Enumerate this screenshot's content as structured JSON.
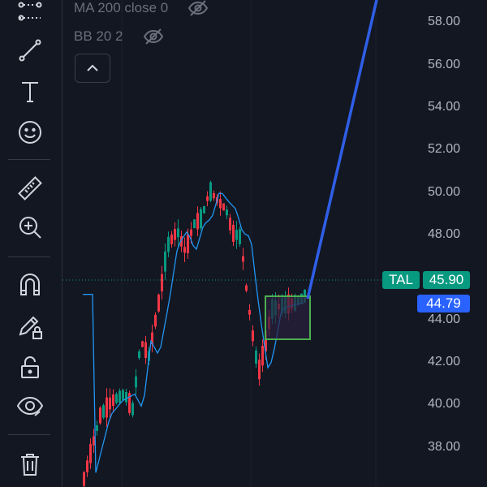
{
  "toolbar": {
    "tools": [
      {
        "name": "trend-pattern-icon"
      },
      {
        "name": "trend-line-icon"
      },
      {
        "name": "text-tool-icon"
      },
      {
        "name": "emoji-icon"
      },
      {
        "name": "ruler-icon"
      },
      {
        "name": "zoom-in-icon"
      },
      {
        "name": "magnet-icon"
      },
      {
        "name": "lock-drawings-icon"
      },
      {
        "name": "unlock-icon"
      },
      {
        "name": "eye-icon"
      },
      {
        "name": "trash-icon"
      }
    ]
  },
  "legend": {
    "ma_label": "MA 200 close 0",
    "bb_label": "BB 20 2"
  },
  "price_axis": {
    "labels": [
      "58.00",
      "56.00",
      "54.00",
      "52.00",
      "50.00",
      "48.00",
      "46.00",
      "44.00",
      "42.00",
      "40.00",
      "38.00"
    ]
  },
  "symbol_tag": {
    "symbol": "TAL",
    "price": "45.90",
    "color": "#089981"
  },
  "crosshair_tag": {
    "price": "44.79",
    "color": "#2962ff"
  },
  "colors": {
    "up": "#089981",
    "down": "#f23645",
    "ma_line": "#2196f3",
    "projection": "#2f5fe8",
    "box_border": "#4caf50",
    "box_fill": "#2a1f3d"
  }
}
